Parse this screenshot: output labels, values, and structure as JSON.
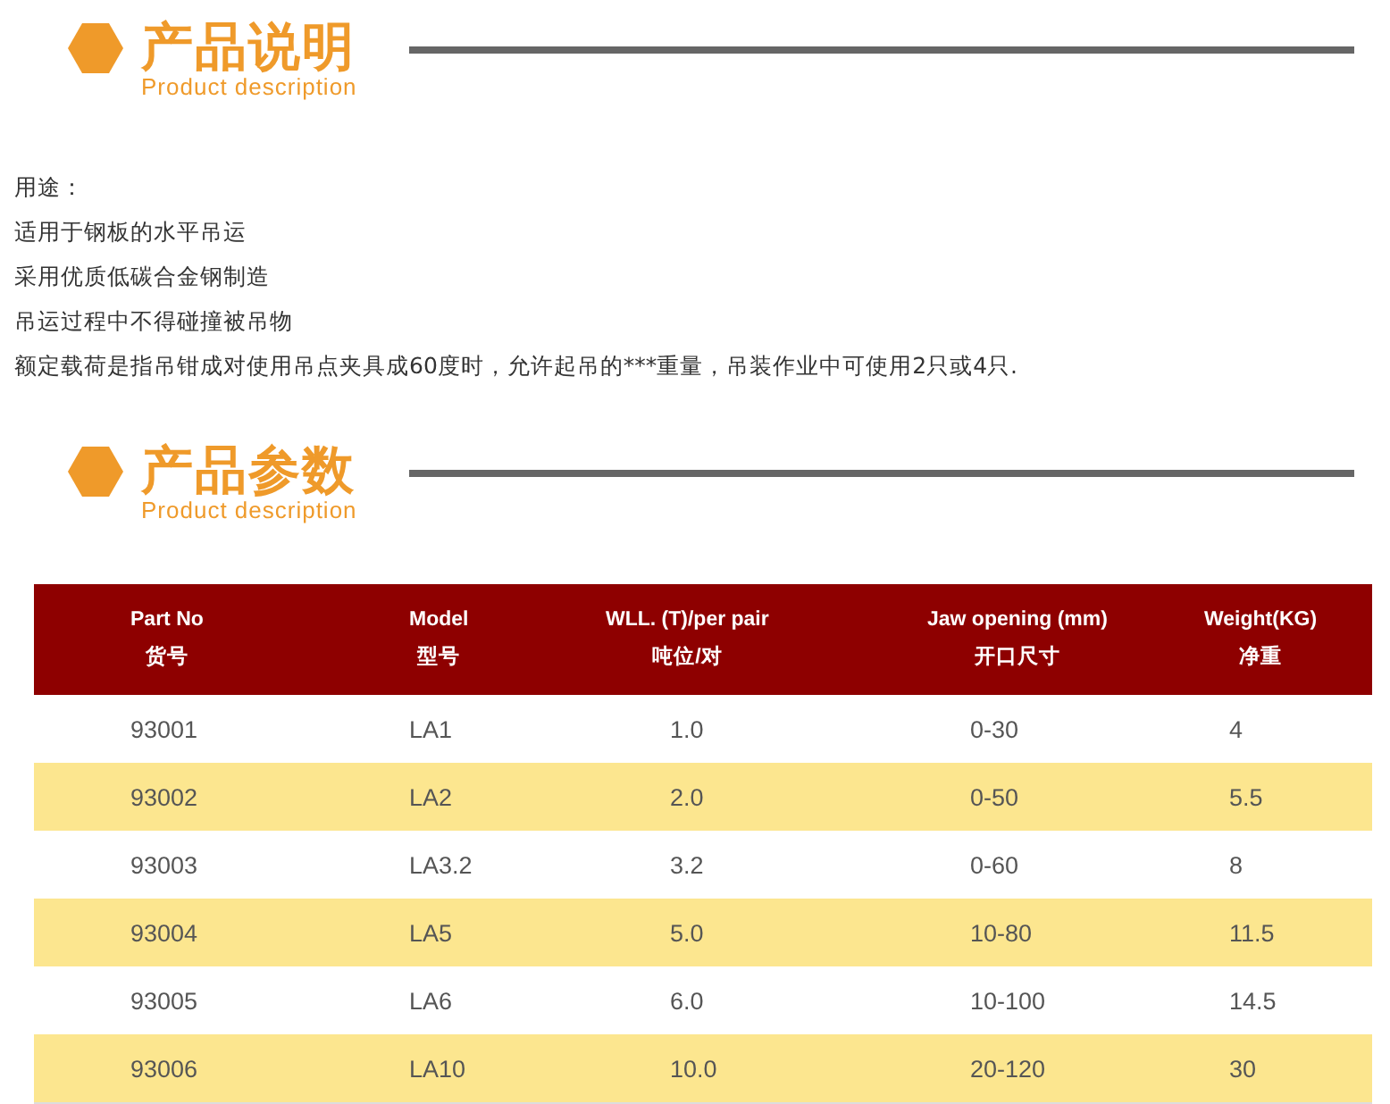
{
  "sections": [
    {
      "title": "产品说明",
      "subtitle": "Product description"
    },
    {
      "title": "产品参数",
      "subtitle": "Product description"
    }
  ],
  "description": [
    "用途：",
    "适用于钢板的水平吊运",
    "采用优质低碳合金钢制造",
    "吊运过程中不得碰撞被吊物",
    "额定载荷是指吊钳成对使用吊点夹具成60度时，允许起吊的***重量，吊装作业中可使用2只或4只."
  ],
  "table": {
    "columns": [
      {
        "en": "Part No",
        "zh": "货号"
      },
      {
        "en": "Model",
        "zh": "型号"
      },
      {
        "en": "WLL. (T)/per pair",
        "zh": "吨位/对"
      },
      {
        "en": "Jaw opening (mm)",
        "zh": "开口尺寸"
      },
      {
        "en": "Weight(KG)",
        "zh": "净重"
      }
    ],
    "rows": [
      [
        "93001",
        "LA1",
        "1.0",
        "0-30",
        "4"
      ],
      [
        "93002",
        "LA2",
        "2.0",
        "0-50",
        "5.5"
      ],
      [
        "93003",
        "LA3.2",
        "3.2",
        "0-60",
        "8"
      ],
      [
        "93004",
        "LA5",
        "5.0",
        "10-80",
        "11.5"
      ],
      [
        "93005",
        "LA6",
        "6.0",
        "10-100",
        "14.5"
      ],
      [
        "93006",
        "LA10",
        "10.0",
        "20-120",
        "30"
      ]
    ]
  }
}
